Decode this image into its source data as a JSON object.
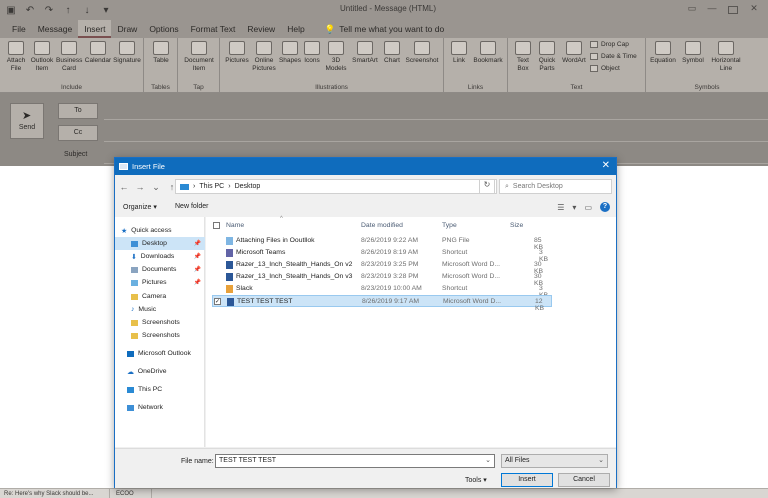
{
  "window": {
    "title": "Untitled - Message (HTML)"
  },
  "menu": {
    "tabs": [
      "File",
      "Message",
      "Insert",
      "Draw",
      "Options",
      "Format Text",
      "Review",
      "Help"
    ],
    "active": "Insert",
    "tell_me": "Tell me what you want to do"
  },
  "ribbon": {
    "include": {
      "label": "Include",
      "attach": "Attach File",
      "outlook_item": "Outlook Item",
      "business_card": "Business Card",
      "calendar": "Calendar",
      "signature": "Signature"
    },
    "tables": {
      "label": "Tables",
      "table": "Table"
    },
    "tap": {
      "label": "Tap",
      "document_item": "Document Item"
    },
    "illustrations": {
      "label": "Illustrations",
      "pictures": "Pictures",
      "online_pictures": "Online Pictures",
      "shapes": "Shapes",
      "icons": "Icons",
      "models_3d": "3D Models",
      "smartart": "SmartArt",
      "chart": "Chart",
      "screenshot": "Screenshot"
    },
    "links": {
      "label": "Links",
      "link": "Link",
      "bookmark": "Bookmark"
    },
    "text": {
      "label": "Text",
      "text_box": "Text Box",
      "quick_parts": "Quick Parts",
      "wordart": "WordArt",
      "drop_cap": "Drop Cap",
      "date_time": "Date & Time",
      "object": "Object"
    },
    "symbols": {
      "label": "Symbols",
      "equation": "Equation",
      "symbol": "Symbol",
      "horizontal_line": "Horizontal Line"
    }
  },
  "compose": {
    "send": "Send",
    "to": "To",
    "cc": "Cc",
    "subject": "Subject"
  },
  "dialog": {
    "title": "Insert File",
    "path": [
      "This PC",
      "Desktop"
    ],
    "search_placeholder": "Search Desktop",
    "organize": "Organize",
    "new_folder": "New folder",
    "nav": [
      {
        "label": "Quick access",
        "icon": "star-icon"
      },
      {
        "label": "Desktop",
        "icon": "folder-icon",
        "selected": true,
        "pinned": true
      },
      {
        "label": "Downloads",
        "icon": "download-icon",
        "pinned": true
      },
      {
        "label": "Documents",
        "icon": "document-icon",
        "pinned": true
      },
      {
        "label": "Pictures",
        "icon": "picture-icon",
        "pinned": true
      },
      {
        "label": "Camera",
        "icon": "folder-icon"
      },
      {
        "label": "Music",
        "icon": "music-icon"
      },
      {
        "label": "Screenshots",
        "icon": "folder-icon"
      },
      {
        "label": "Screenshots",
        "icon": "folder-icon"
      },
      {
        "label": "Microsoft Outlook",
        "icon": "outlook-icon"
      },
      {
        "label": "OneDrive",
        "icon": "cloud-icon"
      },
      {
        "label": "This PC",
        "icon": "pc-icon"
      },
      {
        "label": "Network",
        "icon": "network-icon"
      }
    ],
    "columns": {
      "name": "Name",
      "date": "Date modified",
      "type": "Type",
      "size": "Size"
    },
    "files": [
      {
        "name": "Attaching Files in Ooutllok",
        "date": "8/26/2019 9:22 AM",
        "type": "PNG File",
        "size": "85 KB"
      },
      {
        "name": "Microsoft Teams",
        "date": "8/26/2019 8:19 AM",
        "type": "Shortcut",
        "size": "3 KB"
      },
      {
        "name": "Razer_13_Inch_Stealth_Hands_On v2",
        "date": "8/23/2019 3:25 PM",
        "type": "Microsoft Word D...",
        "size": "30 KB"
      },
      {
        "name": "Razer_13_Inch_Stealth_Hands_On v3",
        "date": "8/23/2019 3:28 PM",
        "type": "Microsoft Word D...",
        "size": "30 KB"
      },
      {
        "name": "Slack",
        "date": "8/23/2019 10:00 AM",
        "type": "Shortcut",
        "size": "3 KB"
      },
      {
        "name": "TEST TEST TEST",
        "date": "8/26/2019 9:17 AM",
        "type": "Microsoft Word D...",
        "size": "12 KB",
        "selected": true
      }
    ],
    "file_name_label": "File name:",
    "file_name_value": "TEST TEST TEST",
    "file_type": "All Files",
    "tools": "Tools",
    "insert": "Insert",
    "cancel": "Cancel"
  },
  "taskbar": {
    "item1": "Re: Here's why Slack should be...",
    "item2": "ECOO"
  },
  "colors": {
    "accent": "#0f6cbd",
    "selection": "#cce4f7"
  }
}
